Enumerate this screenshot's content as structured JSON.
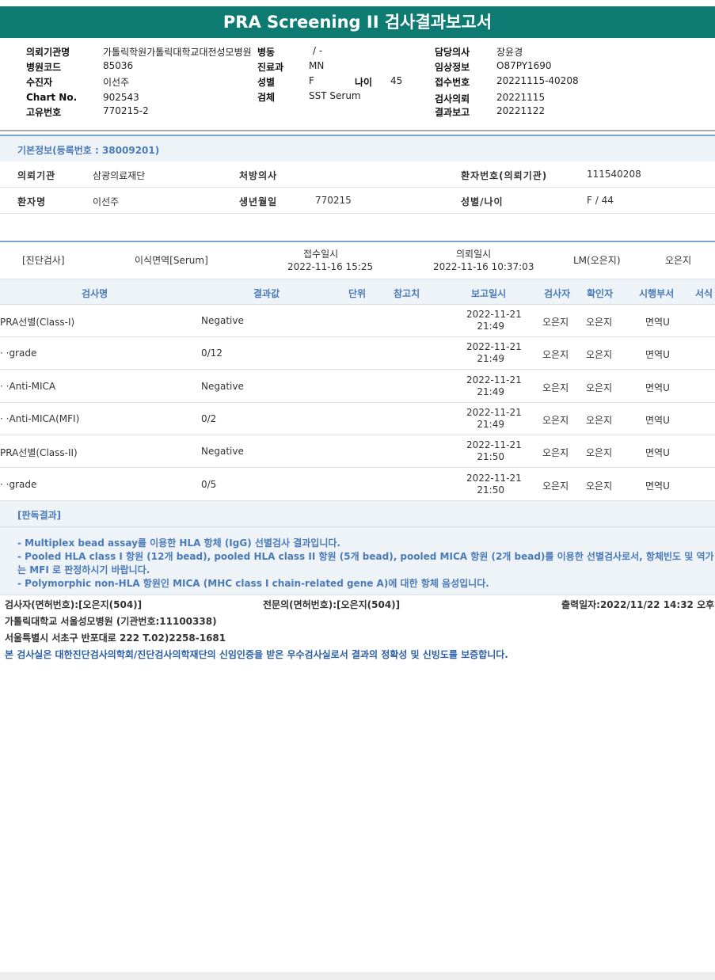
{
  "report_title": "PRA Screening II 검사결과보고서",
  "header": {
    "requesting_org_label": "의뢰기관명",
    "requesting_org": "가톨릭학원가톨릭대학교대전성모병원",
    "ward_label": "병동",
    "ward": "/ -",
    "doctor_label": "담당의사",
    "doctor": "장윤경",
    "hospital_code_label": "병원코드",
    "hospital_code": "85036",
    "department_label": "진료과",
    "department": "MN",
    "clinical_info_label": "임상정보",
    "clinical_info": "O87PY1690",
    "examinee_label": "수진자",
    "examinee": "이선주",
    "sex_label": "성별",
    "sex": "F",
    "age_label": "나이",
    "age": "45",
    "receipt_no_label": "접수번호",
    "receipt_no": "20221115-40208",
    "chart_no_label": "Chart No.",
    "chart_no": "902543",
    "specimen_label": "검체",
    "specimen": "SST Serum",
    "request_date_label": "검사의뢰",
    "request_date": "20221115",
    "unique_no_label": "고유번호",
    "unique_no": "770215-2",
    "report_date_label": "결과보고",
    "report_date": "20221122"
  },
  "basic_info": {
    "section_title": "기본정보(등록번호 : 38009201)",
    "institution_label": "의뢰기관",
    "institution": "삼광의료재단",
    "prescriber_label": "처방의사",
    "prescriber": "",
    "patient_no_label": "환자번호(의뢰기관)",
    "patient_no": "111540208",
    "patient_name_label": "환자명",
    "patient_name": "이선주",
    "birth_label": "생년월일",
    "birth": "770215",
    "sex_age_label": "성별/나이",
    "sex_age": "F / 44"
  },
  "exam": {
    "category": "[진단검사]",
    "name": "이식면역[Serum]",
    "received_label": "접수일시",
    "received": "2022-11-16 15:25",
    "requested_label": "의뢰일시",
    "requested": "2022-11-16 10:37:03",
    "lm": "LM(오은지)",
    "tech": "오은지"
  },
  "table": {
    "headers": {
      "name": "검사명",
      "result": "결과값",
      "unit": "단위",
      "reference": "참고치",
      "report_time": "보고일시",
      "examiner": "검사자",
      "verifier": "확인자",
      "dept": "시행부서",
      "form": "서식"
    },
    "rows": [
      {
        "name": "PRA선별(Class-I)",
        "result": "Negative",
        "date": "2022-11-21",
        "time": "21:49",
        "examiner": "오은지",
        "verifier": "오은지",
        "dept": "면역U"
      },
      {
        "name": "· ·grade",
        "result": "0/12",
        "date": "2022-11-21",
        "time": "21:49",
        "examiner": "오은지",
        "verifier": "오은지",
        "dept": "면역U"
      },
      {
        "name": "· ·Anti-MICA",
        "result": "Negative",
        "date": "2022-11-21",
        "time": "21:49",
        "examiner": "오은지",
        "verifier": "오은지",
        "dept": "면역U"
      },
      {
        "name": "· ·Anti-MICA(MFI)",
        "result": "0/2",
        "date": "2022-11-21",
        "time": "21:49",
        "examiner": "오은지",
        "verifier": "오은지",
        "dept": "면역U"
      },
      {
        "name": "PRA선별(Class-II)",
        "result": "Negative",
        "date": "2022-11-21",
        "time": "21:50",
        "examiner": "오은지",
        "verifier": "오은지",
        "dept": "면역U"
      },
      {
        "name": "· ·grade",
        "result": "0/5",
        "date": "2022-11-21",
        "time": "21:50",
        "examiner": "오은지",
        "verifier": "오은지",
        "dept": "면역U"
      }
    ]
  },
  "interpretation": {
    "title": "[판독결과]",
    "lines": [
      "- Multiplex bead assay를 이용한 HLA 항체 (IgG) 선별검사 결과입니다.",
      "- Pooled HLA class I 항원 (12개 bead), pooled HLA class II 항원 (5개 bead), pooled MICA 항원 (2개 bead)를 이용한 선별검사로서, 항체빈도 및 역가",
      "는 MFI 로 판정하시기 바랍니다.",
      "- Polymorphic non-HLA 항원인 MICA (MHC class I chain-related gene A)에 대한 항체 음성입니다."
    ]
  },
  "footer": {
    "examiner": "검사자(면허번호):[오은지(504)]",
    "specialist": "전문의(면허번호):[오은지(504)]",
    "printed": "출력일자:2022/11/22 14:32 오후",
    "hospital": "가톨릭대학교 서울성모병원 (기관번호:11100338)",
    "address": "서울특별시 서초구 반포대로 222 T.02)2258-1681",
    "certification": "본 검사실은 대한진단검사의학회/진단검사의학재단의 신임인증을 받은 우수검사실로서 결과의 정확성 및 신빙도를 보증합니다."
  },
  "colors": {
    "title_bar": "#0e7b72",
    "section_text": "#4a7ab8",
    "section_bg": "#eef3f8"
  }
}
